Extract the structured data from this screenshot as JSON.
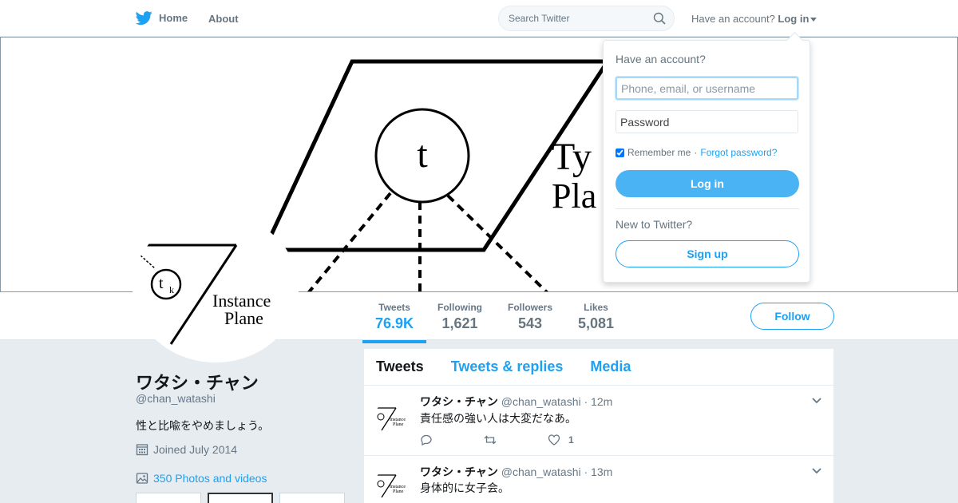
{
  "topbar": {
    "home_label": "Home",
    "about_label": "About",
    "search_placeholder": "Search Twitter",
    "account_prompt": "Have an account?",
    "login_label": "Log in"
  },
  "banner": {
    "text_line1": "Ty",
    "text_line2": "Pla",
    "circle_label": "t"
  },
  "avatar": {
    "circle_label": "t",
    "circle_subscript": "k",
    "text_line1": "Instance",
    "text_line2": "Plane"
  },
  "profile": {
    "name": "ワタシ・チャン",
    "handle": "@chan_watashi",
    "bio": "性と比喩をやめましょう。",
    "joined": "Joined July 2014",
    "photos": "350 Photos and videos"
  },
  "stats": [
    {
      "label": "Tweets",
      "value": "76.9K"
    },
    {
      "label": "Following",
      "value": "1,621"
    },
    {
      "label": "Followers",
      "value": "543"
    },
    {
      "label": "Likes",
      "value": "5,081"
    }
  ],
  "follow_label": "Follow",
  "timeline": {
    "tabs": [
      "Tweets",
      "Tweets & replies",
      "Media"
    ],
    "tweets": [
      {
        "name": "ワタシ・チャン",
        "handle": "@chan_watashi",
        "time": "· 12m",
        "text": "責任感の強い人は大変だなあ。",
        "likes": "1"
      },
      {
        "name": "ワタシ・チャン",
        "handle": "@chan_watashi",
        "time": "· 13m",
        "text": "身体的に女子会。",
        "likes": ""
      }
    ]
  },
  "login_dropdown": {
    "title": "Have an account?",
    "username_placeholder": "Phone, email, or username",
    "password_placeholder": "Password",
    "remember_label": "Remember me",
    "separator": "·",
    "forgot_label": "Forgot password?",
    "login_button": "Log in",
    "new_prompt": "New to Twitter?",
    "signup_button": "Sign up"
  },
  "colors": {
    "accent": "#1da1f2",
    "login_button": "#4ab3f4",
    "background": "#e6ecf0"
  }
}
